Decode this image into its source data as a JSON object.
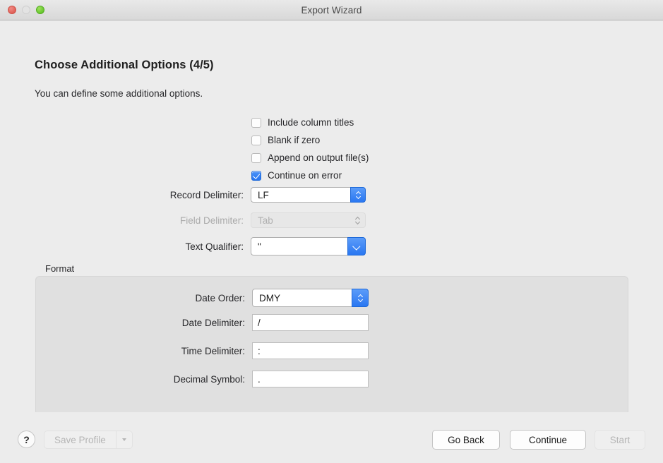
{
  "window": {
    "title": "Export Wizard",
    "controls": {
      "close": "close-button",
      "minimize": "minimize-button",
      "maximize": "maximize-button"
    }
  },
  "page": {
    "title": "Choose Additional Options (4/5)",
    "subtitle": "You can define some additional options."
  },
  "checkboxes": [
    {
      "label": "Include column titles",
      "checked": false
    },
    {
      "label": "Blank if zero",
      "checked": false
    },
    {
      "label": "Append on output file(s)",
      "checked": false
    },
    {
      "label": "Continue on error",
      "checked": true
    }
  ],
  "fields": {
    "record_delimiter": {
      "label": "Record Delimiter:",
      "value": "LF",
      "control": "stepper-combo",
      "enabled": true
    },
    "field_delimiter": {
      "label": "Field Delimiter:",
      "value": "Tab",
      "control": "stepper-combo",
      "enabled": false
    },
    "text_qualifier": {
      "label": "Text Qualifier:",
      "value": "\"",
      "control": "popup-combo",
      "enabled": true
    }
  },
  "format_group": {
    "legend": "Format",
    "date_order": {
      "label": "Date Order:",
      "value": "DMY",
      "control": "stepper-combo",
      "enabled": true
    },
    "date_delimiter": {
      "label": "Date Delimiter:",
      "value": "/",
      "control": "text-field",
      "enabled": true
    },
    "time_delimiter": {
      "label": "Time Delimiter:",
      "value": ":",
      "control": "text-field",
      "enabled": true
    },
    "decimal_symbol": {
      "label": "Decimal Symbol:",
      "value": ".",
      "control": "text-field",
      "enabled": true
    }
  },
  "footer": {
    "help_label": "?",
    "save_profile_label": "Save Profile",
    "save_profile_enabled": false,
    "go_back_label": "Go Back",
    "continue_label": "Continue",
    "start_label": "Start",
    "start_enabled": false
  },
  "colors": {
    "accent_blue": "#2a77f1",
    "window_bg": "#ececec",
    "group_bg": "#e0e0e0",
    "close_red": "#e06058",
    "maximize_green": "#67c72e"
  }
}
